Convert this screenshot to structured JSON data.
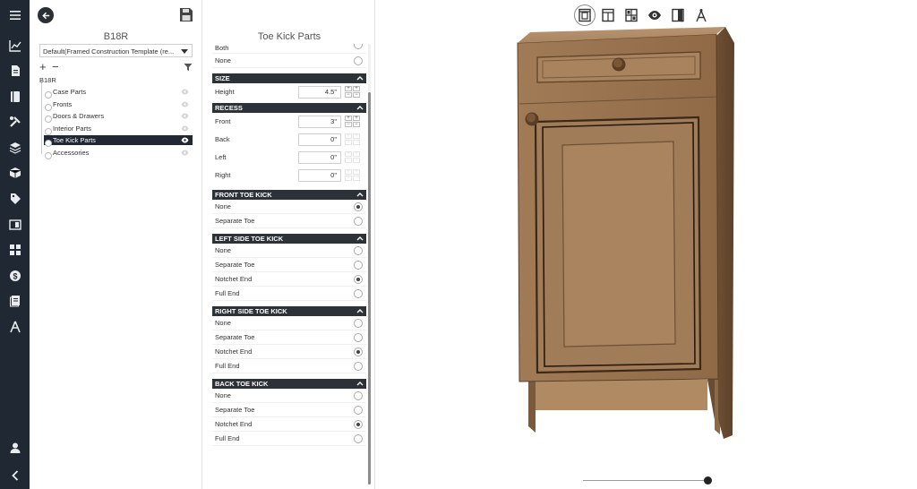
{
  "rail": {
    "top_icon": "menu-icon",
    "icons": [
      "chart-icon",
      "document-icon",
      "book-icon",
      "tools-icon",
      "layers-icon",
      "cube-icon",
      "price-tag-icon",
      "panel-icon",
      "grid-icon",
      "dollar-icon",
      "report-icon",
      "drafting-icon"
    ],
    "bottom_icons": [
      "user-icon",
      "collapse-icon"
    ]
  },
  "tree": {
    "title": "B18R",
    "template_select": "Default(Framed Construction Template (re...",
    "plus": "+",
    "minus": "−",
    "root": "B18R",
    "items": [
      {
        "label": "Case Parts",
        "selected": false
      },
      {
        "label": "Fronts",
        "selected": false
      },
      {
        "label": "Doors & Drawers",
        "selected": false
      },
      {
        "label": "Interior Parts",
        "selected": false
      },
      {
        "label": "Toe Kick Parts",
        "selected": true
      },
      {
        "label": "Accessories",
        "selected": false
      }
    ]
  },
  "props": {
    "title": "Toe Kick Parts",
    "top_rows": {
      "both": "Both",
      "none": "None"
    },
    "size": {
      "header": "SIZE",
      "height_label": "Height",
      "height_value": "4.5\""
    },
    "recess": {
      "header": "RECESS",
      "rows": [
        {
          "label": "Front",
          "value": "3\""
        },
        {
          "label": "Back",
          "value": "0\""
        },
        {
          "label": "Left",
          "value": "0\""
        },
        {
          "label": "Right",
          "value": "0\""
        }
      ]
    },
    "front_toe_kick": {
      "header": "FRONT TOE KICK",
      "options": [
        "None",
        "Separate Toe"
      ],
      "selected": 0
    },
    "left_side_toe_kick": {
      "header": "LEFT SIDE TOE KICK",
      "options": [
        "None",
        "Separate Toe",
        "Notchet End",
        "Full End"
      ],
      "selected": 2
    },
    "right_side_toe_kick": {
      "header": "RIGHT SIDE TOE KICK",
      "options": [
        "None",
        "Separate Toe",
        "Notchet End",
        "Full End"
      ],
      "selected": 2
    },
    "back_toe_kick": {
      "header": "BACK TOE KICK",
      "options": [
        "None",
        "Separate Toe",
        "Notchet End",
        "Full End"
      ],
      "selected": 2
    }
  },
  "viewport": {
    "tools": [
      "cabinet-view-icon",
      "layout-view-icon",
      "elevation-view-icon",
      "eye-icon",
      "door-open-icon",
      "drafting-compass-icon"
    ],
    "active_tool": 0,
    "colors": {
      "wood": "#9a7350",
      "wood_dark": "#6e4f33",
      "wood_light": "#b08a63"
    }
  }
}
